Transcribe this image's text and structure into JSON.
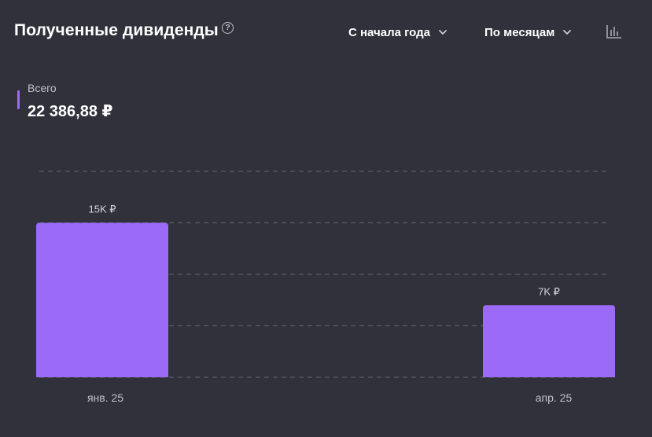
{
  "header": {
    "title": "Полученные дивиденды",
    "help_glyph": "?",
    "period_label": "С начала года",
    "grouping_label": "По месяцам",
    "icons": {
      "help": "question-circle-icon",
      "period_dropdown": "chevron-down-icon",
      "grouping_dropdown": "chevron-down-icon",
      "chart_type": "bar-chart-icon"
    }
  },
  "summary": {
    "label": "Всего",
    "value": "22 386,88 ₽"
  },
  "colors": {
    "background": "#30313b",
    "accent": "#9b6bf7",
    "text": "#ffffff",
    "muted_text": "#bfc1c8",
    "grid": "#5a5b66"
  },
  "chart_data": {
    "type": "bar",
    "categories": [
      "янв. 25",
      "апр. 25"
    ],
    "values": [
      15000,
      7000
    ],
    "value_labels": [
      "15K ₽",
      "7K ₽"
    ],
    "currency": "₽",
    "ylim": [
      0,
      20000
    ],
    "y_gridlines": [
      0,
      5000,
      10000,
      15000,
      20000
    ],
    "grid": true,
    "grid_style": "dashed",
    "legend": "none",
    "title": "",
    "xlabel": "",
    "ylabel": ""
  }
}
